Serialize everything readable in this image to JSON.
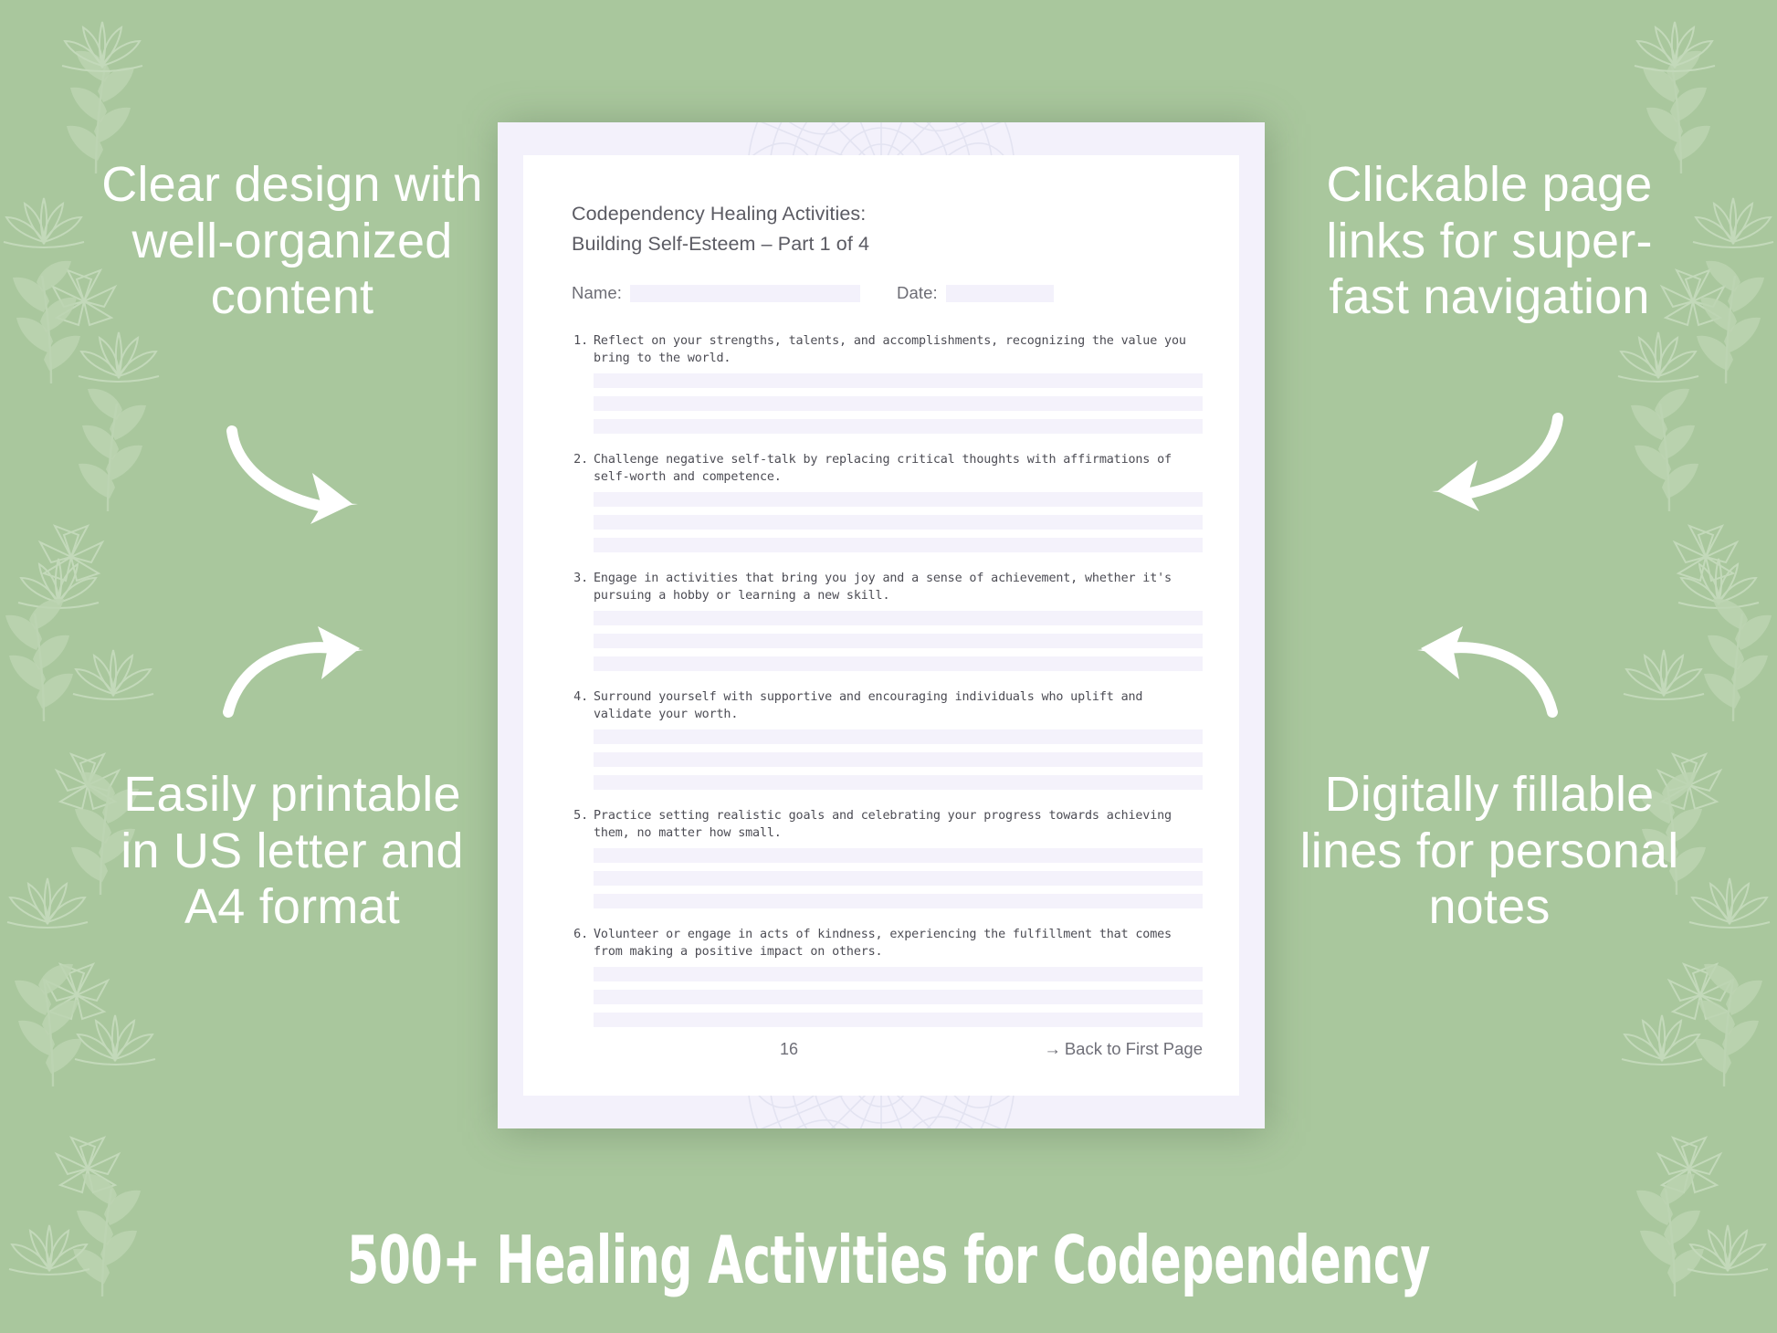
{
  "theme": {
    "background_color": "#a9c79d",
    "doc_backing_color": "#f3f1fb",
    "page_color": "#ffffff",
    "caption_color": "#ffffff",
    "body_text_color": "#4c4c54",
    "fill_line_color": "#f4f2fb"
  },
  "captions": {
    "top_left": "Clear design with well-organized content",
    "bottom_left": "Easily printable in US letter and A4 format",
    "top_right": "Clickable page links for super-fast navigation",
    "bottom_right": "Digitally fillable lines for personal notes"
  },
  "banner": {
    "title": "500+ Healing Activities for Codependency"
  },
  "document": {
    "title_line_1": "Codependency Healing Activities:",
    "title_line_2": "Building Self-Esteem – Part 1 of 4",
    "name_label": "Name:",
    "date_label": "Date:",
    "name_value": "",
    "date_value": "",
    "lines_per_activity": 3,
    "activities": [
      {
        "number": "1.",
        "text": "Reflect on your strengths, talents, and accomplishments, recognizing the value you bring to the world."
      },
      {
        "number": "2.",
        "text": "Challenge negative self-talk by replacing critical thoughts with affirmations of self-worth and competence."
      },
      {
        "number": "3.",
        "text": "Engage in activities that bring you joy and a sense of achievement, whether it's pursuing a hobby or learning a new skill."
      },
      {
        "number": "4.",
        "text": "Surround yourself with supportive and encouraging individuals who uplift and validate your worth."
      },
      {
        "number": "5.",
        "text": "Practice setting realistic goals and celebrating your progress towards achieving them, no matter how small."
      },
      {
        "number": "6.",
        "text": "Volunteer or engage in acts of kindness, experiencing the fulfillment that comes from making a positive impact on others."
      }
    ],
    "footer": {
      "page_number": "16",
      "back_link_arrow": "→",
      "back_link_label": "Back to First Page"
    }
  }
}
